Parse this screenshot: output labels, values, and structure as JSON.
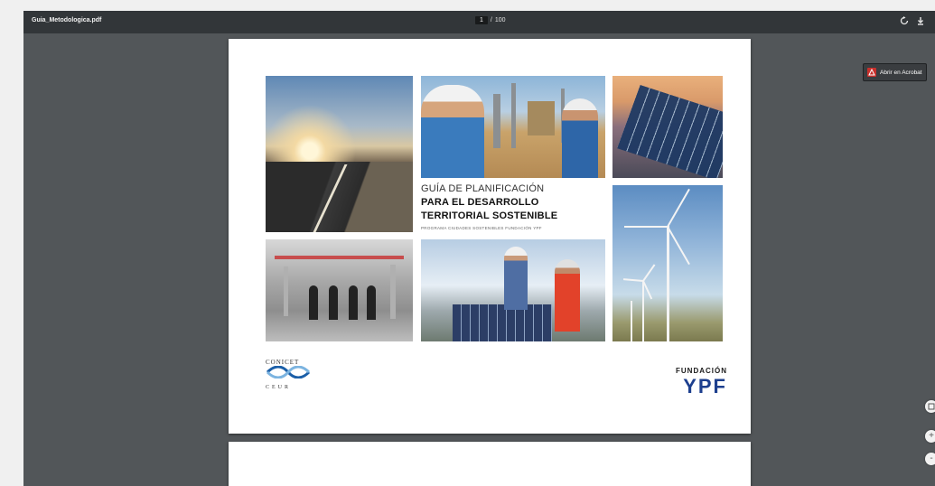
{
  "toolbar": {
    "file_name": "Guia_Metodologica.pdf",
    "current_page": "1",
    "page_separator": "/",
    "total_pages": "100",
    "rotate_icon": "rotate-icon",
    "download_icon": "download-icon"
  },
  "side_button": {
    "label": "Abrir en Acrobat",
    "icon": "adobe-acrobat-icon"
  },
  "cover": {
    "title_line1": "GUÍA DE PLANIFICACIÓN",
    "title_line2": "PARA EL DESARROLLO",
    "title_line3": "TERRITORIAL SOSTENIBLE",
    "subtitle": "PROGRAMA CIUDADES SOSTENIBLES FUNDACIÓN YPF",
    "logo_left_name": "CONICET",
    "logo_left_sub": "CEUR",
    "logo_right_top": "FUNDACIÓN",
    "logo_right_brand": "YPF"
  },
  "zoom_controls": {
    "fit_icon": "fit-page-icon",
    "zoom_in_label": "+",
    "zoom_out_label": "-"
  },
  "colors": {
    "toolbar_bg": "#323639",
    "viewer_bg": "#525659",
    "ypf_blue": "#1d3f8e",
    "acrobat_red": "#c9302c"
  }
}
